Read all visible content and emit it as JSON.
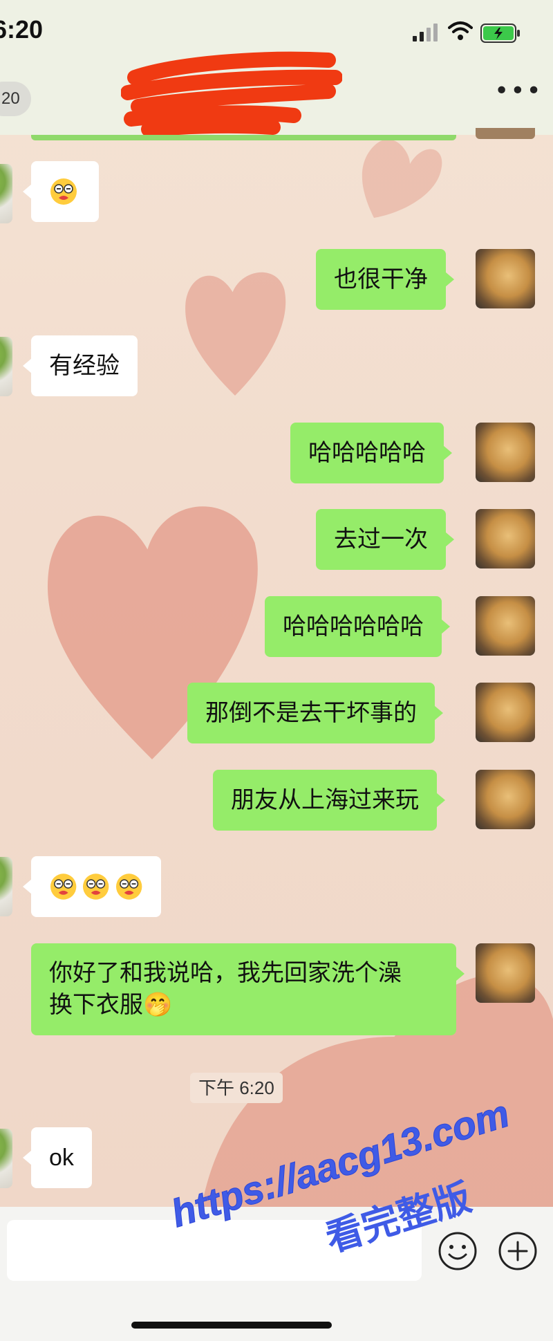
{
  "status_bar": {
    "time": "6:20"
  },
  "nav": {
    "back_count": "20",
    "more_label": "•••"
  },
  "messages": [
    {
      "side": "left",
      "type": "emoji",
      "emojis": [
        "😵"
      ]
    },
    {
      "side": "right",
      "text": "也很干净"
    },
    {
      "side": "left",
      "text": "有经验"
    },
    {
      "side": "right",
      "text": "哈哈哈哈哈"
    },
    {
      "side": "right",
      "text": "去过一次"
    },
    {
      "side": "right",
      "text": "哈哈哈哈哈哈"
    },
    {
      "side": "right",
      "text": "那倒不是去干坏事的"
    },
    {
      "side": "right",
      "text": "朋友从上海过来玩"
    },
    {
      "side": "left",
      "type": "emoji",
      "emojis": [
        "😵",
        "😵",
        "😵"
      ]
    },
    {
      "side": "right",
      "line1": "你好了和我说哈，我先回家洗个澡",
      "line2": "换下衣服",
      "trail_emoji": "🤭"
    },
    {
      "type": "time",
      "text": "下午 6:20"
    },
    {
      "side": "left",
      "text": "ok"
    }
  ],
  "watermark": {
    "url": "https://aacg13.com",
    "sub": "看完整版"
  },
  "colors": {
    "green_bubble": "#95ec69",
    "white_bubble": "#ffffff",
    "watermark": "#3f5be6"
  }
}
